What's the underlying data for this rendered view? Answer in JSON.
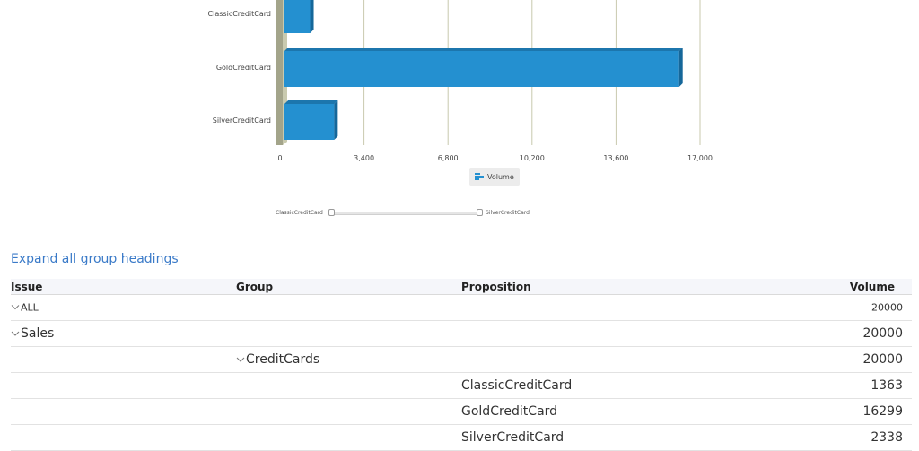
{
  "chart_data": {
    "type": "bar",
    "orientation": "horizontal",
    "categories": [
      "ClassicCreditCard",
      "GoldCreditCard",
      "SilverCreditCard"
    ],
    "values": [
      1363,
      16299,
      2338
    ],
    "xlim": [
      0,
      17000
    ],
    "xticks": [
      "0",
      "3,400",
      "6,800",
      "10,200",
      "13,600",
      "17,000"
    ],
    "legend": "Volume",
    "legend_position": "bottom",
    "bar_color": "#2490d0",
    "grid": true
  },
  "slider": {
    "left_label": "ClassicCreditCard",
    "right_label": "SilverCreditCard"
  },
  "expand_link": "Expand all group headings",
  "grid": {
    "headers": {
      "issue": "Issue",
      "group": "Group",
      "proposition": "Proposition",
      "volume": "Volume"
    },
    "rows": [
      {
        "issue": "ALL",
        "volume": "20000"
      },
      {
        "issue": "Sales",
        "volume": "20000"
      },
      {
        "group": "CreditCards",
        "volume": "20000"
      },
      {
        "proposition": "ClassicCreditCard",
        "volume": "1363"
      },
      {
        "proposition": "GoldCreditCard",
        "volume": "16299"
      },
      {
        "proposition": "SilverCreditCard",
        "volume": "2338"
      }
    ]
  }
}
